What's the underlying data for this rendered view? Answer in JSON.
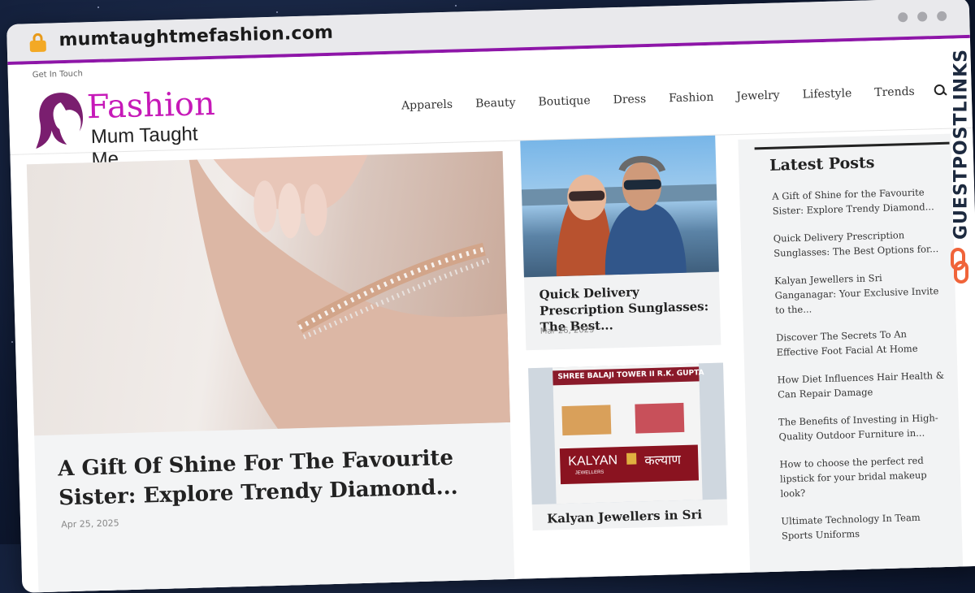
{
  "browser": {
    "url": "mumtaughtmefashion.com"
  },
  "topbar": {
    "get_in_touch": "Get In Touch"
  },
  "logo": {
    "title": "Fashion",
    "subtitle": "Mum Taught Me"
  },
  "nav": {
    "items": [
      "Apparels",
      "Beauty",
      "Boutique",
      "Dress",
      "Fashion",
      "Jewelry",
      "Lifestyle",
      "Trends"
    ]
  },
  "featured": {
    "title": "A Gift Of Shine For The Favourite Sister: Explore Trendy Diamond...",
    "date": "Apr 25, 2025"
  },
  "cards": [
    {
      "title": "Quick Delivery Prescription Sunglasses: The Best...",
      "date": "Mar 26, 2025"
    },
    {
      "title": "Kalyan Jewellers in Sri",
      "sign_top": "SHREE BALAJI TOWER II  R.K. GUPTA",
      "brand_en": "KALYAN",
      "brand_sub": "JEWELLERS",
      "brand_hi": "कल्याण"
    }
  ],
  "sidebar": {
    "heading": "Latest Posts",
    "posts": [
      "A Gift of Shine for the Favourite Sister: Explore Trendy Diamond...",
      "Quick Delivery Prescription Sunglasses: The Best Options for...",
      "Kalyan Jewellers in Sri Ganganagar: Your Exclusive Invite to the...",
      "Discover The Secrets To An Effective Foot Facial At Home",
      "How Diet Influences Hair Health & Can Repair Damage",
      "The Benefits of Investing in High-Quality Outdoor Furniture in...",
      "How to choose the perfect red lipstick for your bridal makeup look?",
      "Ultimate Technology In Team Sports Uniforms"
    ]
  },
  "badge": {
    "text": "GUESTPOSTLINKS"
  },
  "colors": {
    "accent": "#8e16a8",
    "logo_pink": "#c619b8",
    "chrome": "#e9e9ec"
  }
}
